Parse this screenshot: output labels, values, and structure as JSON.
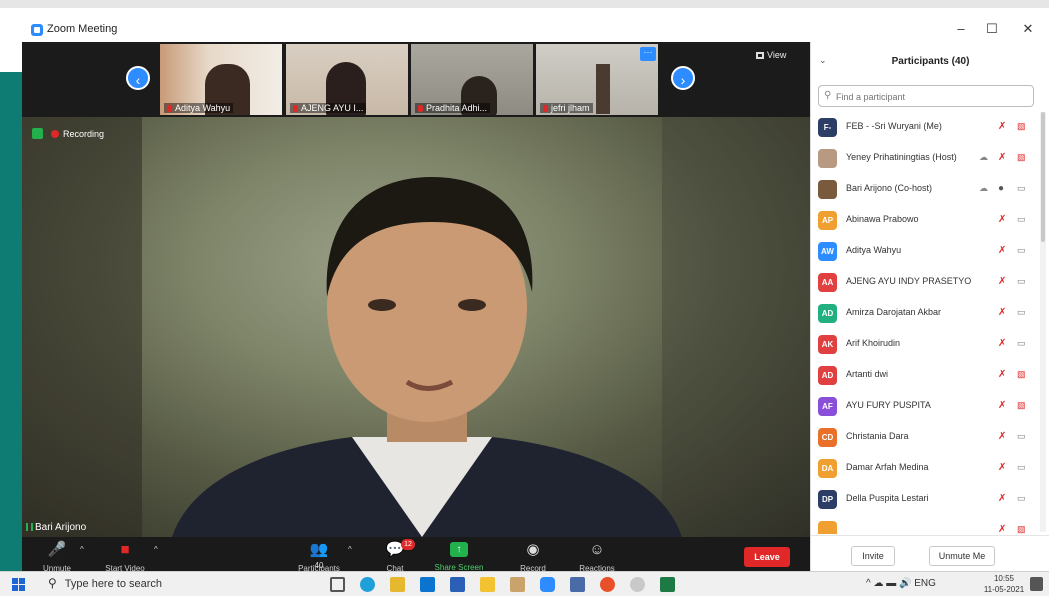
{
  "window": {
    "title": "Zoom Meeting",
    "minimize_glyph": "–",
    "maximize_glyph": "☐",
    "close_glyph": "✕"
  },
  "video": {
    "thumbnails": [
      {
        "name": "Aditya Wahyu"
      },
      {
        "name": "AJENG AYU I..."
      },
      {
        "name": "Pradhita Adhi..."
      },
      {
        "name": "jefri jlham"
      }
    ],
    "prev_glyph": "‹",
    "next_glyph": "›",
    "more_glyph": "···",
    "view_label": "View",
    "recording_label": "Recording",
    "active_speaker": "Bari Arijono"
  },
  "toolbar": {
    "unmute": "Unmute",
    "start_video": "Start Video",
    "participants": "Participants",
    "participants_count": "40",
    "chat": "Chat",
    "chat_badge": "12",
    "share_screen": "Share Screen",
    "record": "Record",
    "reactions": "Reactions",
    "leave": "Leave"
  },
  "panel": {
    "title": "Participants (40)",
    "search_placeholder": "Find a participant",
    "participants": [
      {
        "initials": "F-",
        "name": "FEB - -Sri Wuryani (Me)",
        "color": "#2d3e66",
        "mic": "muted",
        "cam": "off"
      },
      {
        "initials": "",
        "name": "Yeney Prihatiningtias (Host)",
        "color": "#b89a82",
        "mic": "muted",
        "cam": "off",
        "cloud": true
      },
      {
        "initials": "",
        "name": "Bari Arijono (Co-host)",
        "color": "#7a5a3c",
        "mic": "on",
        "cam": "on",
        "cloud": true
      },
      {
        "initials": "AP",
        "name": "Abinawa Prabowo",
        "color": "#f0a030",
        "mic": "muted",
        "cam": "on"
      },
      {
        "initials": "AW",
        "name": "Aditya Wahyu",
        "color": "#2d8cff",
        "mic": "muted",
        "cam": "on"
      },
      {
        "initials": "AA",
        "name": "AJENG AYU INDY PRASETYO",
        "color": "#e04040",
        "mic": "muted",
        "cam": "on"
      },
      {
        "initials": "AD",
        "name": "Amirza Darojatan Akbar",
        "color": "#22b080",
        "mic": "muted",
        "cam": "on"
      },
      {
        "initials": "AK",
        "name": "Arif Khoirudin",
        "color": "#e04040",
        "mic": "muted",
        "cam": "on"
      },
      {
        "initials": "AD",
        "name": "Artanti dwi",
        "color": "#e04040",
        "mic": "muted",
        "cam": "off"
      },
      {
        "initials": "AF",
        "name": "AYU FURY PUSPITA",
        "color": "#8a4fd8",
        "mic": "muted",
        "cam": "off"
      },
      {
        "initials": "CD",
        "name": "Christania Dara",
        "color": "#e8702a",
        "mic": "muted",
        "cam": "on"
      },
      {
        "initials": "DA",
        "name": "Damar Arfah Medina",
        "color": "#f0a030",
        "mic": "muted",
        "cam": "on"
      },
      {
        "initials": "DP",
        "name": "Della Puspita Lestari",
        "color": "#2d3e66",
        "mic": "muted",
        "cam": "on"
      },
      {
        "initials": "",
        "name": "",
        "color": "#f0a030",
        "mic": "muted",
        "cam": "off"
      }
    ],
    "invite": "Invite",
    "unmute_me": "Unmute Me"
  },
  "taskbar": {
    "search_placeholder": "Type here to search",
    "tray_text": "^ ☁ ▬ 🔊 ENG",
    "time": "10:55",
    "date": "11-05-2021"
  }
}
